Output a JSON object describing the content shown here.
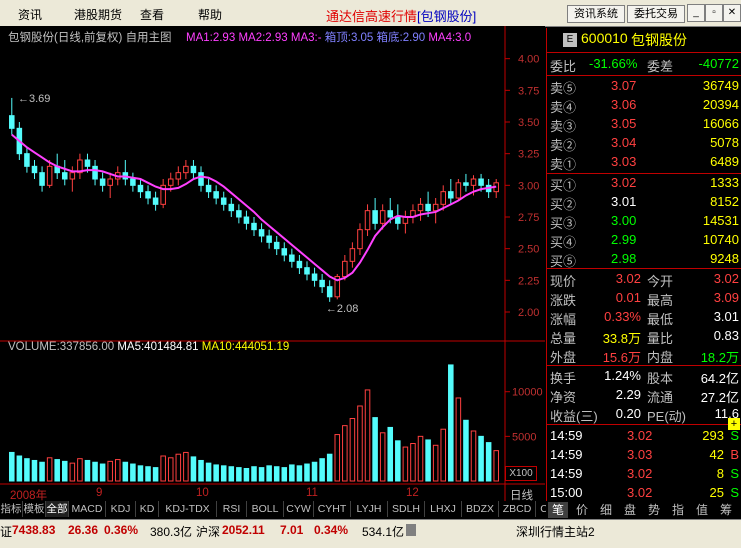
{
  "menubar": {
    "items": [
      "资讯",
      "港股期货",
      "查看",
      "帮助"
    ],
    "title": "通达信高速行情",
    "title_stock": "[包钢股份]",
    "buttons": [
      "资讯系统",
      "委托交易"
    ],
    "window_controls": [
      "minimize-icon",
      "restore-icon",
      "close-icon"
    ]
  },
  "chart": {
    "title": "包钢股份(日线,前复权)",
    "main_label": "自用主图",
    "indicators": [
      {
        "label": "MA1:2.93",
        "color": "#ff40ff"
      },
      {
        "label": "MA2:2.93",
        "color": "#ff40ff"
      },
      {
        "label": "MA3:-",
        "color": "#ff40ff"
      },
      {
        "label": "箱顶:3.05",
        "color": "#8080ff"
      },
      {
        "label": "箱底:2.90",
        "color": "#8080ff"
      },
      {
        "label": "MA4:3.0",
        "color": "#ff40ff"
      }
    ],
    "price_ticks": [
      "4.00",
      "3.75",
      "3.50",
      "3.25",
      "3.00",
      "2.75",
      "2.50",
      "2.25",
      "2.00"
    ],
    "high_label": "3.69",
    "low_label": "2.08",
    "volume_label": "VOLUME:337856.00",
    "ma5_label": "MA5:401484.81",
    "ma10_label": "MA10:444051.19",
    "volume_ticks": [
      "10000",
      "5000"
    ],
    "volume_unit": "X100",
    "x_labels": [
      "2008年",
      "9",
      "10",
      "11",
      "12"
    ],
    "period": "日线"
  },
  "chart_data": {
    "type": "candlestick",
    "ylim": [
      1.85,
      4.1
    ],
    "ohlc": [
      [
        3.55,
        3.69,
        3.4,
        3.45
      ],
      [
        3.45,
        3.5,
        3.2,
        3.25
      ],
      [
        3.25,
        3.3,
        3.1,
        3.15
      ],
      [
        3.15,
        3.2,
        3.05,
        3.1
      ],
      [
        3.1,
        3.15,
        2.95,
        3.0
      ],
      [
        3.0,
        3.2,
        2.98,
        3.15
      ],
      [
        3.15,
        3.25,
        3.05,
        3.1
      ],
      [
        3.1,
        3.2,
        3.0,
        3.05
      ],
      [
        3.05,
        3.15,
        2.95,
        3.1
      ],
      [
        3.1,
        3.25,
        3.05,
        3.2
      ],
      [
        3.2,
        3.25,
        3.1,
        3.15
      ],
      [
        3.15,
        3.2,
        3.0,
        3.05
      ],
      [
        3.05,
        3.1,
        2.95,
        3.0
      ],
      [
        3.0,
        3.1,
        2.9,
        3.05
      ],
      [
        3.05,
        3.15,
        3.0,
        3.1
      ],
      [
        3.1,
        3.2,
        3.0,
        3.05
      ],
      [
        3.05,
        3.1,
        2.95,
        3.0
      ],
      [
        3.0,
        3.05,
        2.9,
        2.95
      ],
      [
        2.95,
        3.0,
        2.85,
        2.9
      ],
      [
        2.9,
        2.95,
        2.8,
        2.85
      ],
      [
        2.85,
        3.05,
        2.82,
        3.0
      ],
      [
        3.0,
        3.1,
        2.95,
        3.05
      ],
      [
        3.05,
        3.15,
        3.0,
        3.1
      ],
      [
        3.1,
        3.2,
        3.05,
        3.15
      ],
      [
        3.15,
        3.2,
        3.05,
        3.1
      ],
      [
        3.1,
        3.15,
        2.95,
        3.0
      ],
      [
        3.0,
        3.05,
        2.9,
        2.95
      ],
      [
        2.95,
        3.0,
        2.85,
        2.9
      ],
      [
        2.9,
        2.95,
        2.8,
        2.85
      ],
      [
        2.85,
        2.9,
        2.75,
        2.8
      ],
      [
        2.8,
        2.85,
        2.7,
        2.75
      ],
      [
        2.75,
        2.8,
        2.65,
        2.7
      ],
      [
        2.7,
        2.75,
        2.6,
        2.65
      ],
      [
        2.65,
        2.7,
        2.55,
        2.6
      ],
      [
        2.6,
        2.65,
        2.5,
        2.55
      ],
      [
        2.55,
        2.6,
        2.45,
        2.5
      ],
      [
        2.5,
        2.55,
        2.4,
        2.45
      ],
      [
        2.45,
        2.5,
        2.35,
        2.4
      ],
      [
        2.4,
        2.45,
        2.3,
        2.35
      ],
      [
        2.35,
        2.4,
        2.25,
        2.3
      ],
      [
        2.3,
        2.35,
        2.2,
        2.25
      ],
      [
        2.25,
        2.3,
        2.15,
        2.2
      ],
      [
        2.2,
        2.25,
        2.08,
        2.12
      ],
      [
        2.12,
        2.3,
        2.1,
        2.28
      ],
      [
        2.28,
        2.45,
        2.25,
        2.4
      ],
      [
        2.4,
        2.55,
        2.35,
        2.5
      ],
      [
        2.5,
        2.7,
        2.45,
        2.65
      ],
      [
        2.65,
        2.85,
        2.6,
        2.8
      ],
      [
        2.8,
        2.9,
        2.65,
        2.7
      ],
      [
        2.7,
        2.85,
        2.65,
        2.8
      ],
      [
        2.8,
        2.9,
        2.7,
        2.75
      ],
      [
        2.75,
        2.85,
        2.65,
        2.7
      ],
      [
        2.7,
        2.8,
        2.62,
        2.75
      ],
      [
        2.75,
        2.85,
        2.7,
        2.8
      ],
      [
        2.8,
        2.9,
        2.72,
        2.85
      ],
      [
        2.85,
        2.95,
        2.75,
        2.8
      ],
      [
        2.8,
        2.9,
        2.7,
        2.85
      ],
      [
        2.85,
        3.0,
        2.8,
        2.95
      ],
      [
        2.95,
        3.05,
        2.85,
        2.9
      ],
      [
        2.9,
        3.05,
        2.88,
        3.02
      ],
      [
        3.02,
        3.09,
        2.95,
        3.0
      ],
      [
        3.0,
        3.08,
        2.92,
        3.05
      ],
      [
        3.05,
        3.09,
        2.95,
        3.0
      ],
      [
        3.0,
        3.05,
        2.9,
        2.95
      ],
      [
        2.95,
        3.05,
        2.9,
        3.02
      ]
    ],
    "volume": [
      3200,
      2800,
      2500,
      2300,
      2100,
      2600,
      2400,
      2200,
      2000,
      2500,
      2300,
      2100,
      1900,
      2200,
      2400,
      2100,
      1900,
      1700,
      1600,
      1500,
      2800,
      2600,
      3000,
      3200,
      2700,
      2300,
      2000,
      1800,
      1700,
      1600,
      1500,
      1400,
      1600,
      1500,
      1700,
      1600,
      1500,
      1800,
      1700,
      1900,
      2100,
      2500,
      3000,
      5200,
      6200,
      7000,
      8400,
      10200,
      7100,
      5400,
      6000,
      4500,
      3800,
      4200,
      5000,
      4600,
      4000,
      5800,
      13000,
      9300,
      6800,
      5600,
      5000,
      4300,
      3400
    ],
    "ma5": [
      3.4,
      3.35,
      3.3,
      3.26,
      3.22,
      3.18,
      3.15,
      3.13,
      3.11,
      3.11,
      3.12,
      3.12,
      3.11,
      3.09,
      3.07,
      3.07,
      3.06,
      3.05,
      3.02,
      2.99,
      2.97,
      2.97,
      2.98,
      3.01,
      3.05,
      3.07,
      3.06,
      3.03,
      2.99,
      2.94,
      2.89,
      2.84,
      2.79,
      2.73,
      2.68,
      2.63,
      2.58,
      2.53,
      2.48,
      2.43,
      2.38,
      2.33,
      2.28,
      2.25,
      2.27,
      2.31,
      2.39,
      2.49,
      2.6,
      2.67,
      2.73,
      2.76,
      2.75,
      2.75,
      2.77,
      2.78,
      2.79,
      2.82,
      2.85,
      2.88,
      2.92,
      2.95,
      2.97,
      2.98,
      2.99
    ],
    "volume_ylim": [
      0,
      14000
    ]
  },
  "quote": {
    "code": "600010",
    "name": "包钢股份",
    "weibi_label": "委比",
    "weibi_value": "-31.66%",
    "weicha_label": "委差",
    "weicha_value": "-40772",
    "sells": [
      {
        "label": "卖⑤",
        "price": "3.07",
        "vol": "36749"
      },
      {
        "label": "卖④",
        "price": "3.06",
        "vol": "20394"
      },
      {
        "label": "卖③",
        "price": "3.05",
        "vol": "16066"
      },
      {
        "label": "卖②",
        "price": "3.04",
        "vol": "5078"
      },
      {
        "label": "卖①",
        "price": "3.03",
        "vol": "6489"
      }
    ],
    "buys": [
      {
        "label": "买①",
        "price": "3.02",
        "vol": "1333",
        "color": "#ff4040"
      },
      {
        "label": "买②",
        "price": "3.01",
        "vol": "8152",
        "color": "#ffffff"
      },
      {
        "label": "买③",
        "price": "3.00",
        "vol": "14531",
        "color": "#00ff00"
      },
      {
        "label": "买④",
        "price": "2.99",
        "vol": "10740",
        "color": "#00ff00"
      },
      {
        "label": "买⑤",
        "price": "2.98",
        "vol": "9248",
        "color": "#00ff00"
      }
    ],
    "stats": [
      {
        "l1": "现价",
        "v1": "3.02",
        "c1": "#ff4040",
        "l2": "今开",
        "v2": "3.02",
        "c2": "#ff4040"
      },
      {
        "l1": "涨跌",
        "v1": "0.01",
        "c1": "#ff4040",
        "l2": "最高",
        "v2": "3.09",
        "c2": "#ff4040"
      },
      {
        "l1": "涨幅",
        "v1": "0.33%",
        "c1": "#ff4040",
        "l2": "最低",
        "v2": "3.01",
        "c2": "#ffffff"
      },
      {
        "l1": "总量",
        "v1": "33.8万",
        "c1": "#ffff00",
        "l2": "量比",
        "v2": "0.83",
        "c2": "#ffffff"
      },
      {
        "l1": "外盘",
        "v1": "15.6万",
        "c1": "#ff4040",
        "l2": "内盘",
        "v2": "18.2万",
        "c2": "#00ff00"
      }
    ],
    "stats2": [
      {
        "l1": "换手",
        "v1": "1.24%",
        "l2": "股本",
        "v2": "64.2亿"
      },
      {
        "l1": "净资",
        "v1": "2.29",
        "l2": "流通",
        "v2": "27.2亿"
      },
      {
        "l1": "收益(三)",
        "v1": "0.20",
        "l2": "PE(动)",
        "v2": "11.6"
      }
    ],
    "ticks": [
      {
        "time": "14:59",
        "price": "3.02",
        "vol": "293",
        "side": "S",
        "color": "#00ff00"
      },
      {
        "time": "14:59",
        "price": "3.03",
        "vol": "42",
        "side": "B",
        "color": "#ff4040"
      },
      {
        "time": "14:59",
        "price": "3.02",
        "vol": "8",
        "side": "S",
        "color": "#00ff00"
      },
      {
        "time": "15:00",
        "price": "3.02",
        "vol": "25",
        "side": "S",
        "color": "#00ff00"
      }
    ]
  },
  "tabs": [
    "指标",
    "模板",
    "全部",
    "MACD",
    "KDJ",
    "KD",
    "KDJ-TDX",
    "RSI",
    "BOLL",
    "CYW",
    "CYHT",
    "LYJH",
    "SDLH",
    "LHXJ",
    "BDZX",
    "ZBCD",
    "CJDX"
  ],
  "bottom_tabs": [
    "笔",
    "价",
    "细",
    "盘",
    "势",
    "指",
    "值",
    "筹"
  ],
  "status": {
    "idx1_label": "证",
    "idx1_value": "7438.83",
    "idx1_change": "26.36",
    "idx1_pct": "0.36%",
    "idx1_amount": "380.3亿",
    "idx2_label": "沪深",
    "idx2_value": "2052.11",
    "idx2_change": "7.01",
    "idx2_pct": "0.34%",
    "idx2_amount": "534.1亿",
    "server": "深圳行情主站2"
  }
}
